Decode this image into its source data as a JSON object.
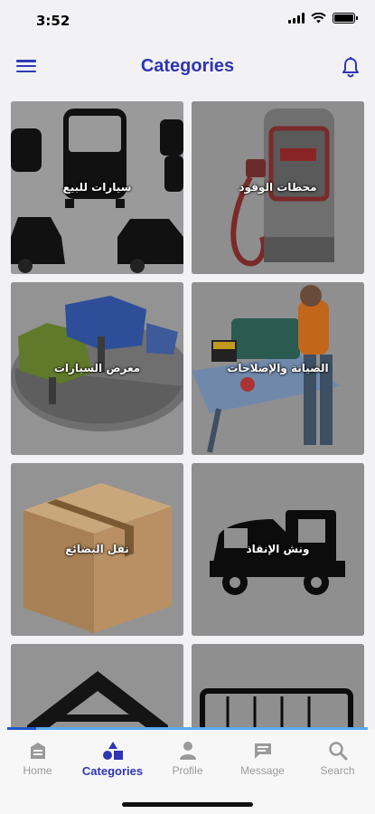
{
  "status_bar": {
    "time": "3:52"
  },
  "header": {
    "title": "Categories"
  },
  "categories": [
    {
      "label": "محطات الوقود"
    },
    {
      "label": "سيارات للبيع"
    },
    {
      "label": "الصيانة والإصلاحات"
    },
    {
      "label": "معرض السيارات"
    },
    {
      "label": "ونش الإنقاذ"
    },
    {
      "label": "نقل البضائع"
    },
    {
      "label": ""
    },
    {
      "label": ""
    }
  ],
  "tabbar": {
    "active": "Categories",
    "tabs": [
      {
        "label": "Home",
        "icon": "home-icon"
      },
      {
        "label": "Categories",
        "icon": "categories-icon"
      },
      {
        "label": "Profile",
        "icon": "profile-icon"
      },
      {
        "label": "Message",
        "icon": "message-icon"
      },
      {
        "label": "Search",
        "icon": "search-icon"
      }
    ]
  },
  "colors": {
    "accent": "#2f35b5",
    "tile_bg": "#8d8d8d",
    "inactive": "#9a9a9a"
  }
}
